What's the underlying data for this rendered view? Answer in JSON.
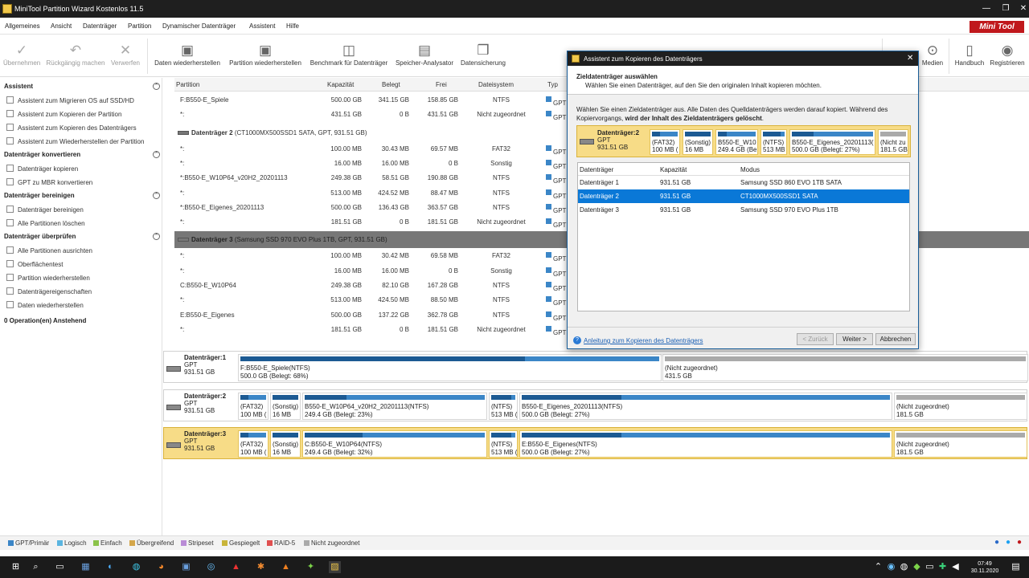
{
  "window": {
    "title": "MiniTool Partition Wizard Kostenlos 11.5",
    "brand": "Mini Tool",
    "controls": [
      "—",
      "❐",
      "✕"
    ]
  },
  "menu": [
    "Allgemeines",
    "Ansicht",
    "Datenträger",
    "Partition",
    "Dynamischer Datenträger",
    "Assistent",
    "Hilfe"
  ],
  "toolbar": {
    "undo_group": [
      {
        "label": "Übernehmen",
        "icon": "check-icon"
      },
      {
        "label": "Rückgängig machen",
        "icon": "undo-icon"
      },
      {
        "label": "Verwerfen",
        "icon": "x-icon"
      }
    ],
    "main": [
      {
        "label": "Daten wiederherstellen",
        "icon": "data-recovery-icon"
      },
      {
        "label": "Partition wiederherstellen",
        "icon": "partition-recovery-icon"
      },
      {
        "label": "Benchmark für Datenträger",
        "icon": "benchmark-icon"
      },
      {
        "label": "Speicher-Analysator",
        "icon": "space-analyzer-icon"
      },
      {
        "label": "Datensicherung",
        "icon": "backup-icon"
      }
    ],
    "right": [
      {
        "label": "Medien",
        "icon": "media-icon"
      },
      {
        "label": "Handbuch",
        "icon": "manual-icon"
      },
      {
        "label": "Registrieren",
        "icon": "register-icon"
      }
    ]
  },
  "sidebar": {
    "sections": [
      {
        "title": "Assistent",
        "items": [
          "Assistent zum Migrieren OS auf SSD/HD",
          "Assistent zum Kopieren der Partition",
          "Assistent zum Kopieren des Datenträgers",
          "Assistent zum Wiederherstellen der Partition"
        ]
      },
      {
        "title": "Datenträger konvertieren",
        "items": [
          "Datenträger kopieren",
          "GPT zu MBR konvertieren"
        ]
      },
      {
        "title": "Datenträger bereinigen",
        "items": [
          "Datenträger bereinigen",
          "Alle Partitionen löschen"
        ]
      },
      {
        "title": "Datenträger überprüfen",
        "items": [
          "Alle Partitionen ausrichten",
          "Oberflächentest",
          "Partition wiederherstellen",
          "Datenträgereigenschaften",
          "Daten wiederherstellen"
        ]
      }
    ],
    "pending": "0 Operation(en) Anstehend"
  },
  "grid": {
    "headers": [
      "Partition",
      "Kapazität",
      "Belegt",
      "Frei",
      "Dateisystem",
      "Typ"
    ],
    "rows": [
      {
        "kind": "part",
        "name": "F:B550-E_Spiele",
        "cap": "500.00 GB",
        "used": "341.15 GB",
        "free": "158.85 GB",
        "fs": "NTFS",
        "type": "GPT"
      },
      {
        "kind": "part",
        "name": "*:",
        "cap": "431.51 GB",
        "used": "0 B",
        "free": "431.51 GB",
        "fs": "Nicht zugeordnet",
        "type": "GPT"
      },
      {
        "kind": "disk",
        "name": "Datenträger 2",
        "info": "(CT1000MX500SSD1 SATA, GPT, 931.51 GB)"
      },
      {
        "kind": "part",
        "name": "*:",
        "cap": "100.00 MB",
        "used": "30.43 MB",
        "free": "69.57 MB",
        "fs": "FAT32",
        "type": "GPT"
      },
      {
        "kind": "part",
        "name": "*:",
        "cap": "16.00 MB",
        "used": "16.00 MB",
        "free": "0 B",
        "fs": "Sonstig",
        "type": "GPT"
      },
      {
        "kind": "part",
        "name": "*:B550-E_W10P64_v20H2_20201113",
        "cap": "249.38 GB",
        "used": "58.51 GB",
        "free": "190.88 GB",
        "fs": "NTFS",
        "type": "GPT"
      },
      {
        "kind": "part",
        "name": "*:",
        "cap": "513.00 MB",
        "used": "424.52 MB",
        "free": "88.47 MB",
        "fs": "NTFS",
        "type": "GPT"
      },
      {
        "kind": "part",
        "name": "*:B550-E_Eigenes_20201113",
        "cap": "500.00 GB",
        "used": "136.43 GB",
        "free": "363.57 GB",
        "fs": "NTFS",
        "type": "GPT"
      },
      {
        "kind": "part",
        "name": "*:",
        "cap": "181.51 GB",
        "used": "0 B",
        "free": "181.51 GB",
        "fs": "Nicht zugeordnet",
        "type": "GPT"
      },
      {
        "kind": "disk",
        "name": "Datenträger 3",
        "info": "(Samsung SSD 970 EVO Plus 1TB, GPT, 931.51 GB)",
        "selected": true
      },
      {
        "kind": "part",
        "name": "*:",
        "cap": "100.00 MB",
        "used": "30.42 MB",
        "free": "69.58 MB",
        "fs": "FAT32",
        "type": "GPT"
      },
      {
        "kind": "part",
        "name": "*:",
        "cap": "16.00 MB",
        "used": "16.00 MB",
        "free": "0 B",
        "fs": "Sonstig",
        "type": "GPT"
      },
      {
        "kind": "part",
        "name": "C:B550-E_W10P64",
        "cap": "249.38 GB",
        "used": "82.10 GB",
        "free": "167.28 GB",
        "fs": "NTFS",
        "type": "GPT"
      },
      {
        "kind": "part",
        "name": "*:",
        "cap": "513.00 MB",
        "used": "424.50 MB",
        "free": "88.50 MB",
        "fs": "NTFS",
        "type": "GPT"
      },
      {
        "kind": "part",
        "name": "E:B550-E_Eigenes",
        "cap": "500.00 GB",
        "used": "137.22 GB",
        "free": "362.78 GB",
        "fs": "NTFS",
        "type": "GPT"
      },
      {
        "kind": "part",
        "name": "*:",
        "cap": "181.51 GB",
        "used": "0 B",
        "free": "181.51 GB",
        "fs": "Nicht zugeordnet",
        "type": "GPT"
      }
    ]
  },
  "diskmap": [
    {
      "name": "Datenträger:1",
      "style": "GPT",
      "size": "931.51 GB",
      "parts": [
        {
          "l1": "F:B550-E_Spiele(NTFS)",
          "l2": "500.0 GB (Belegt: 68%)",
          "used": 0.68
        },
        {
          "l1": "(Nicht zugeordnet)",
          "l2": "431.5 GB",
          "unalloc": true
        }
      ]
    },
    {
      "name": "Datenträger:2",
      "style": "GPT",
      "size": "931.51 GB",
      "parts": [
        {
          "l1": "(FAT32)",
          "l2": "100 MB (",
          "used": 0.3
        },
        {
          "l1": "(Sonstig)",
          "l2": "16 MB",
          "used": 1
        },
        {
          "l1": "B550-E_W10P64_v20H2_20201113(NTFS)",
          "l2": "249.4 GB (Belegt: 23%)",
          "used": 0.23
        },
        {
          "l1": "(NTFS)",
          "l2": "513 MB (",
          "used": 0.83
        },
        {
          "l1": "B550-E_Eigenes_20201113(NTFS)",
          "l2": "500.0 GB (Belegt: 27%)",
          "used": 0.27
        },
        {
          "l1": "(Nicht zugeordnet)",
          "l2": "181.5 GB",
          "unalloc": true
        }
      ]
    },
    {
      "name": "Datenträger:3",
      "style": "GPT",
      "size": "931.51 GB",
      "selected": true,
      "parts": [
        {
          "l1": "(FAT32)",
          "l2": "100 MB (",
          "used": 0.3
        },
        {
          "l1": "(Sonstig)",
          "l2": "16 MB",
          "used": 1
        },
        {
          "l1": "C:B550-E_W10P64(NTFS)",
          "l2": "249.4 GB (Belegt: 32%)",
          "used": 0.32
        },
        {
          "l1": "(NTFS)",
          "l2": "513 MB (",
          "used": 0.83
        },
        {
          "l1": "E:B550-E_Eigenes(NTFS)",
          "l2": "500.0 GB (Belegt: 27%)",
          "used": 0.27
        },
        {
          "l1": "(Nicht zugeordnet)",
          "l2": "181.5 GB",
          "unalloc": true
        }
      ]
    }
  ],
  "legend": [
    {
      "label": "GPT/Primär",
      "color": "#3b86c7"
    },
    {
      "label": "Logisch",
      "color": "#5bb5e0"
    },
    {
      "label": "Einfach",
      "color": "#8bc34a"
    },
    {
      "label": "Übergreifend",
      "color": "#d4a64a"
    },
    {
      "label": "Stripeset",
      "color": "#b98cd6"
    },
    {
      "label": "Gespiegelt",
      "color": "#c9b53a"
    },
    {
      "label": "RAID-5",
      "color": "#e05050"
    },
    {
      "label": "Nicht zugeordnet",
      "color": "#aaaaaa"
    }
  ],
  "dialog": {
    "title": "Assistent zum Kopieren des Datenträgers",
    "heading": "Zieldatenträger auswählen",
    "subheading": "Wählen Sie einen Datenträger, auf den Sie den originalen Inhalt kopieren möchten.",
    "desc1": "Wählen Sie einen Zieldatenträger aus. Alle Daten des Quelldatenträgers werden darauf kopiert. Während des",
    "desc2_normal": "Kopiervorgangs, ",
    "desc2_bold": "wird der Inhalt des Zieldatenträgers gelöscht",
    "desc2_end": ".",
    "map": {
      "name": "Datenträger:2",
      "style": "GPT",
      "size": "931.51 GB",
      "parts": [
        {
          "l1": "(FAT32)",
          "l2": "100 MB (",
          "used": 0.3
        },
        {
          "l1": "(Sonstig)",
          "l2": "16 MB",
          "used": 1
        },
        {
          "l1": "B550-E_W10",
          "l2": "249.4 GB (Be",
          "used": 0.23
        },
        {
          "l1": "(NTFS)",
          "l2": "513 MB (",
          "used": 0.83
        },
        {
          "l1": "B550-E_Eigenes_20201113(",
          "l2": "500.0 GB (Belegt: 27%)",
          "used": 0.27
        },
        {
          "l1": "(Nicht zu",
          "l2": "181.5 GB",
          "unalloc": true
        }
      ]
    },
    "list_headers": [
      "Datenträger",
      "Kapazität",
      "Modus"
    ],
    "list_rows": [
      {
        "disk": "Datenträger 1",
        "cap": "931.51 GB",
        "mode": "Samsung SSD 860 EVO 1TB SATA"
      },
      {
        "disk": "Datenträger 2",
        "cap": "931.51 GB",
        "mode": "CT1000MX500SSD1 SATA",
        "selected": true
      },
      {
        "disk": "Datenträger 3",
        "cap": "931.51 GB",
        "mode": "Samsung SSD 970 EVO Plus 1TB"
      }
    ],
    "help_link": "Anleitung zum Kopieren des Datenträgers",
    "buttons": {
      "back": "< Zurück",
      "next": "Weiter >",
      "cancel": "Abbrechen"
    }
  },
  "taskbar": {
    "time": "07:49",
    "date": "30.11.2020"
  },
  "colors": {
    "primary": "#3b86c7",
    "used": "#1c5a93",
    "selected": "#f7dc87",
    "unalloc": "#aaaaaa",
    "select_blue": "#0a78d7"
  }
}
